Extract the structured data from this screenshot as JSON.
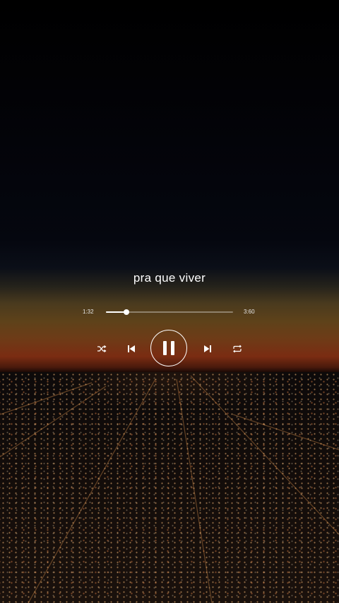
{
  "player": {
    "song_title": "pra que viver",
    "current_time": "1:32",
    "total_time": "3:60",
    "progress": 0.16,
    "state": "playing"
  },
  "controls": {
    "shuffle_icon": "shuffle-icon",
    "previous_icon": "skip-previous-icon",
    "pause_icon": "pause-icon",
    "next_icon": "skip-next-icon",
    "repeat_icon": "repeat-icon"
  },
  "colors": {
    "text": "#ffffff",
    "horizon_glow": "#7a2c12"
  }
}
